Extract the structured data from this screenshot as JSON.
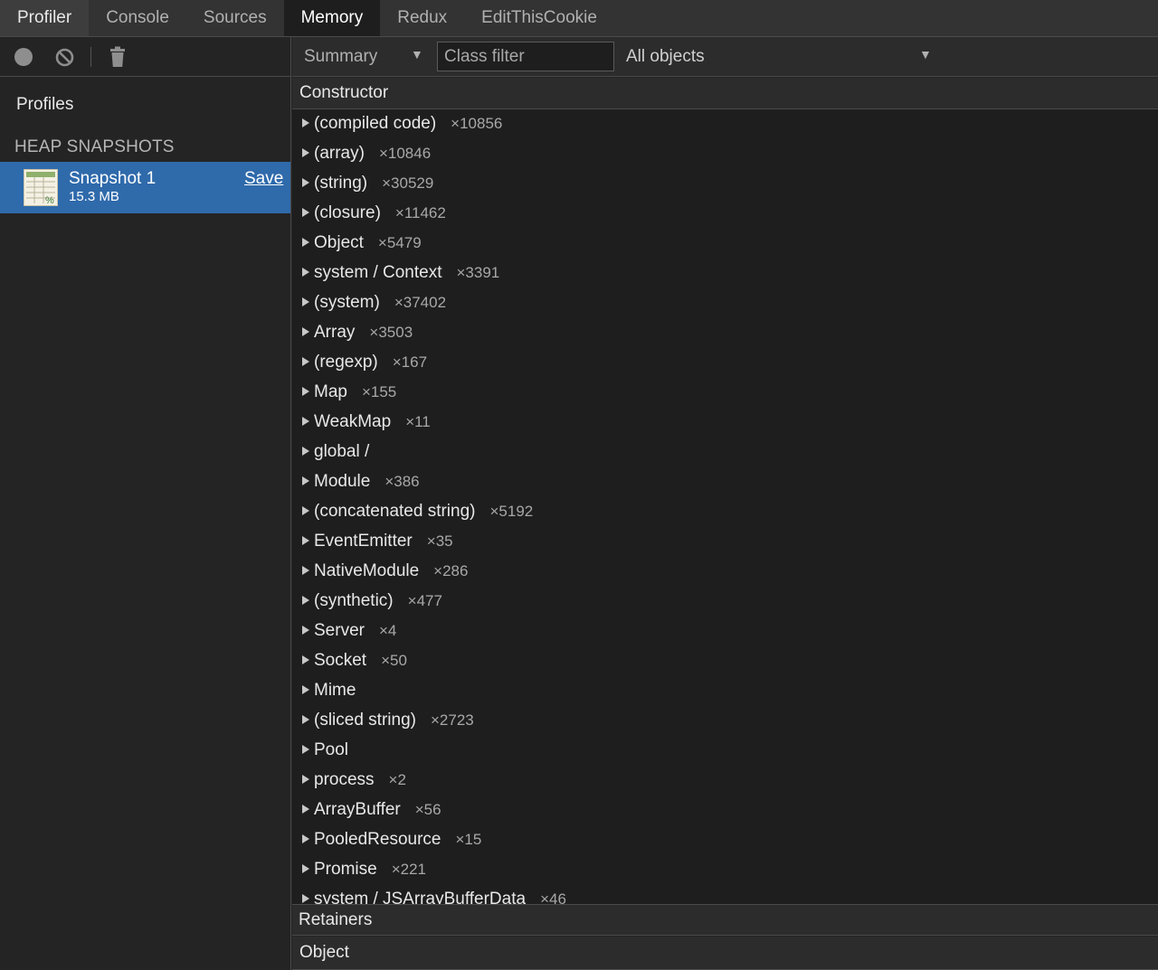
{
  "tabs": [
    {
      "label": "Profiler"
    },
    {
      "label": "Console"
    },
    {
      "label": "Sources"
    },
    {
      "label": "Memory"
    },
    {
      "label": "Redux"
    },
    {
      "label": "EditThisCookie"
    }
  ],
  "sidebar": {
    "profiles_label": "Profiles",
    "section_title": "HEAP SNAPSHOTS",
    "snapshot": {
      "name": "Snapshot 1",
      "size": "15.3 MB",
      "save_label": "Save"
    }
  },
  "filter_bar": {
    "view_select": "Summary",
    "class_filter_placeholder": "Class filter",
    "objects_select": "All objects"
  },
  "table": {
    "column_header": "Constructor",
    "rows": [
      {
        "name": "(compiled code)",
        "count": "×10856"
      },
      {
        "name": "(array)",
        "count": "×10846"
      },
      {
        "name": "(string)",
        "count": "×30529"
      },
      {
        "name": "(closure)",
        "count": "×11462"
      },
      {
        "name": "Object",
        "count": "×5479"
      },
      {
        "name": "system / Context",
        "count": "×3391"
      },
      {
        "name": "(system)",
        "count": "×37402"
      },
      {
        "name": "Array",
        "count": "×3503"
      },
      {
        "name": "(regexp)",
        "count": "×167"
      },
      {
        "name": "Map",
        "count": "×155"
      },
      {
        "name": "WeakMap",
        "count": "×11"
      },
      {
        "name": "global /",
        "count": ""
      },
      {
        "name": "Module",
        "count": "×386"
      },
      {
        "name": "(concatenated string)",
        "count": "×5192"
      },
      {
        "name": "EventEmitter",
        "count": "×35"
      },
      {
        "name": "NativeModule",
        "count": "×286"
      },
      {
        "name": "(synthetic)",
        "count": "×477"
      },
      {
        "name": "Server",
        "count": "×4"
      },
      {
        "name": "Socket",
        "count": "×50"
      },
      {
        "name": "Mime",
        "count": ""
      },
      {
        "name": "(sliced string)",
        "count": "×2723"
      },
      {
        "name": "Pool",
        "count": ""
      },
      {
        "name": "process",
        "count": "×2"
      },
      {
        "name": "ArrayBuffer",
        "count": "×56"
      },
      {
        "name": "PooledResource",
        "count": "×15"
      },
      {
        "name": "Promise",
        "count": "×221"
      },
      {
        "name": "system / JSArrayBufferData",
        "count": "×46"
      }
    ]
  },
  "retainers": {
    "title": "Retainers"
  },
  "object_header": {
    "title": "Object"
  },
  "icons": {
    "record": "record-icon",
    "clear": "clear-icon",
    "trash": "trash-icon",
    "snapshot": "heap-snapshot-icon",
    "dropdown": "triangle-down-icon",
    "expand": "triangle-right-icon"
  },
  "colors": {
    "selection": "#2f6aab",
    "background": "#1e1e1e",
    "panel": "#2c2c2c"
  }
}
